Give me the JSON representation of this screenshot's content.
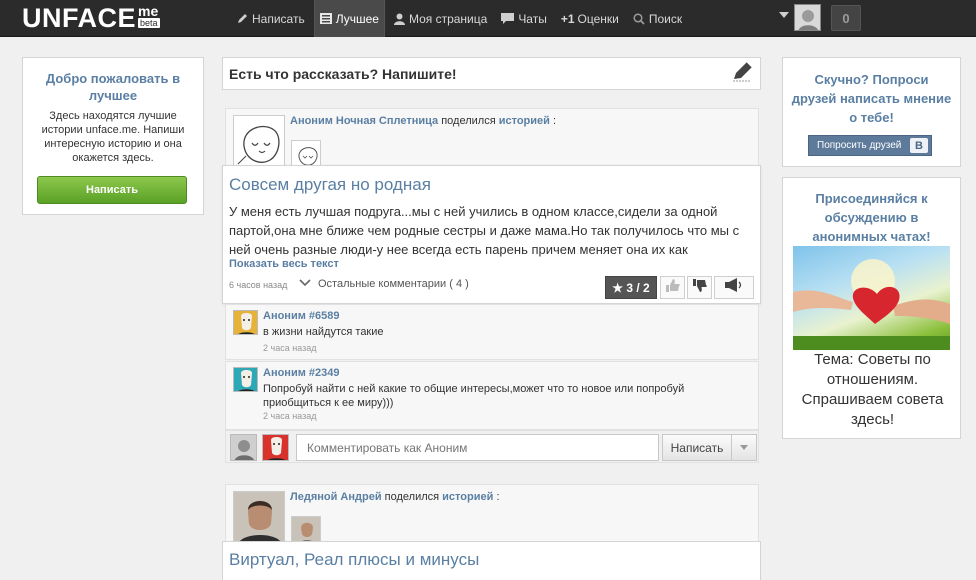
{
  "header": {
    "logo": "UNFACE",
    "logo_sup": "me",
    "logo_beta": "beta",
    "nav": [
      {
        "label": "Написать",
        "icon": "pencil-icon"
      },
      {
        "label": "Лучшее",
        "icon": "list-icon",
        "active": true
      },
      {
        "label": "Моя страница",
        "icon": "user-icon"
      },
      {
        "label": "Чаты",
        "icon": "chat-icon"
      },
      {
        "prefix": "+1",
        "label": "Оценки",
        "icon": ""
      },
      {
        "label": "Поиск",
        "icon": "search-icon"
      }
    ],
    "notifications": "0"
  },
  "welcome": {
    "title": "Добро пожаловать в лучшее",
    "text": "Здесь находятся лучшие истории unface.me. Напиши интересную историю и она окажется здесь.",
    "button": "Написать"
  },
  "compose": {
    "prompt": "Есть что рассказать? Напишите!"
  },
  "story1": {
    "author": "Аноним Ночная Сплетница",
    "shared": "поделился",
    "shared_link": "историей",
    "colon": ":",
    "title": "Совсем другая но родная",
    "text": "У меня есть лучшая подруга...мы с ней учились в одном классе,сидели за одной партой,она мне ближе чем родные сестры и даже мама.Но так получилось что мы с ней очень разные люди-у нее всегда есть парень причем меняет она их как",
    "show_all": "Показать весь текст",
    "time": "6 часов назад",
    "more_comments": "Остальные комментарии ( 4 )",
    "rating": "★ 3 / 2"
  },
  "comments": [
    {
      "author": "Аноним #6589",
      "text": "в жизни найдутся такие",
      "time": "2 часа назад"
    },
    {
      "author": "Аноним #2349",
      "text": "Попробуй найти с ней какие то общие интересы,может что то новое или попробуй приобщиться к ее миру)))",
      "time": "2 часа назад"
    }
  ],
  "reply": {
    "placeholder": "Комментировать как Аноним",
    "button": "Написать"
  },
  "story2": {
    "author": "Ледяной Андрей",
    "shared": "поделился",
    "shared_link": "историей",
    "colon": ":",
    "title": "Виртуал, Реал плюсы и минусы"
  },
  "sidebar_right": {
    "ask_title": "Скучно? Попроси друзей написать мнение о тебе!",
    "ask_button": "Попросить друзей",
    "vk_badge": "В",
    "join_title": "Присоединяйся к обсуждению в анонимных чатах!",
    "topic": "Тема: Советы по отношениям. Спрашиваем совета здесь!"
  },
  "colors": {
    "accent": "#5a7fa3",
    "topbar": "#2b2b2b",
    "green": "#6ab42f"
  }
}
